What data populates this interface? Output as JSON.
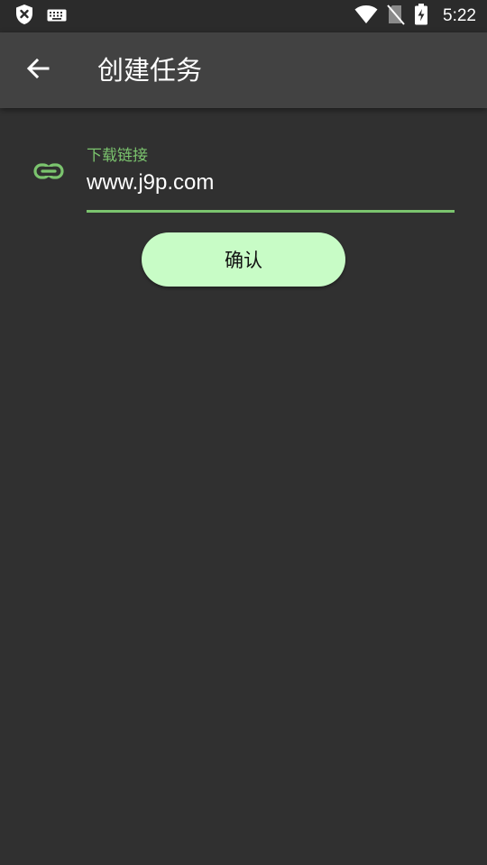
{
  "status_bar": {
    "time": "5:22",
    "icons": [
      "shield-x-icon",
      "keyboard-icon",
      "wifi-icon",
      "no-sim-icon",
      "battery-charging-icon"
    ]
  },
  "app_bar": {
    "title": "创建任务",
    "back_icon": "arrow-left-icon"
  },
  "form": {
    "link_icon": "link-icon",
    "label": "下载链接",
    "value": "www.j9p.com",
    "accent_color": "#7bc46e"
  },
  "confirm_button": {
    "label": "确认",
    "color": "#c8fcc6"
  },
  "theme": {
    "background": "#303030",
    "app_bar": "#424242",
    "status_bar": "#2b2b2b"
  }
}
